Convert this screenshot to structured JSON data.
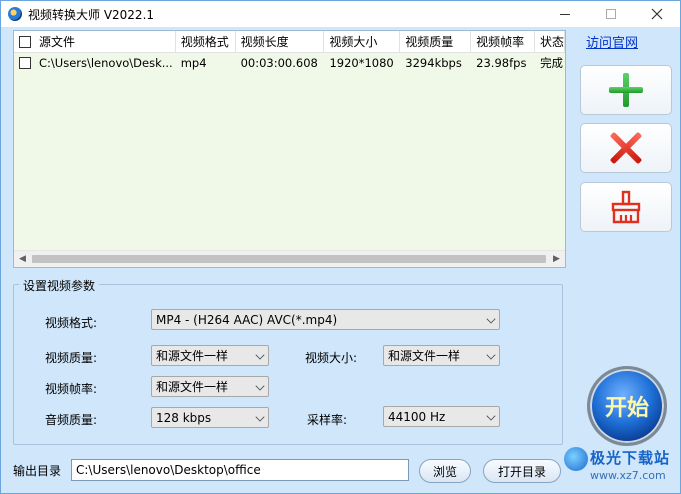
{
  "window": {
    "title": "视频转换大师 V2022.1",
    "controls": [
      "minimize",
      "maximize",
      "close"
    ]
  },
  "file_list": {
    "columns": [
      "源文件",
      "视频格式",
      "视频长度",
      "视频大小",
      "视频质量",
      "视频帧率",
      "状态"
    ],
    "rows": [
      {
        "checked": false,
        "source": "C:\\Users\\lenovo\\Desk...",
        "format": "mp4",
        "duration": "00:03:00.608",
        "size": "1920*1080",
        "quality": "3294kbps",
        "fps": "23.98fps",
        "status": "完成"
      }
    ]
  },
  "sidebar": {
    "visit_link": "访问官网",
    "buttons": [
      "add-icon",
      "delete-icon",
      "clear-icon"
    ]
  },
  "settings": {
    "group_title": "设置视频参数",
    "video_format_label": "视频格式:",
    "video_format_value": "MP4 - (H264 AAC) AVC(*.mp4)",
    "video_quality_label": "视频质量:",
    "video_quality_value": "和源文件一样",
    "video_size_label": "视频大小:",
    "video_size_value": "和源文件一样",
    "video_fps_label": "视频帧率:",
    "video_fps_value": "和源文件一样",
    "audio_quality_label": "音频质量:",
    "audio_quality_value": "128 kbps",
    "sample_rate_label": "采样率:",
    "sample_rate_value": "44100 Hz"
  },
  "start_button": "开始",
  "output": {
    "label": "输出目录",
    "path": "C:\\Users\\lenovo\\Desktop\\office",
    "browse_label": "浏览",
    "open_label": "打开目录"
  },
  "watermark": {
    "title": "极光下载站",
    "url": "www.xz7.com"
  },
  "colors": {
    "window_bg": "#cfe6fb",
    "list_bg": "#f0f8e8",
    "link": "#0033cc",
    "add": "#1d9a2a",
    "delete": "#c8160b",
    "start_text": "#fff8a8"
  }
}
